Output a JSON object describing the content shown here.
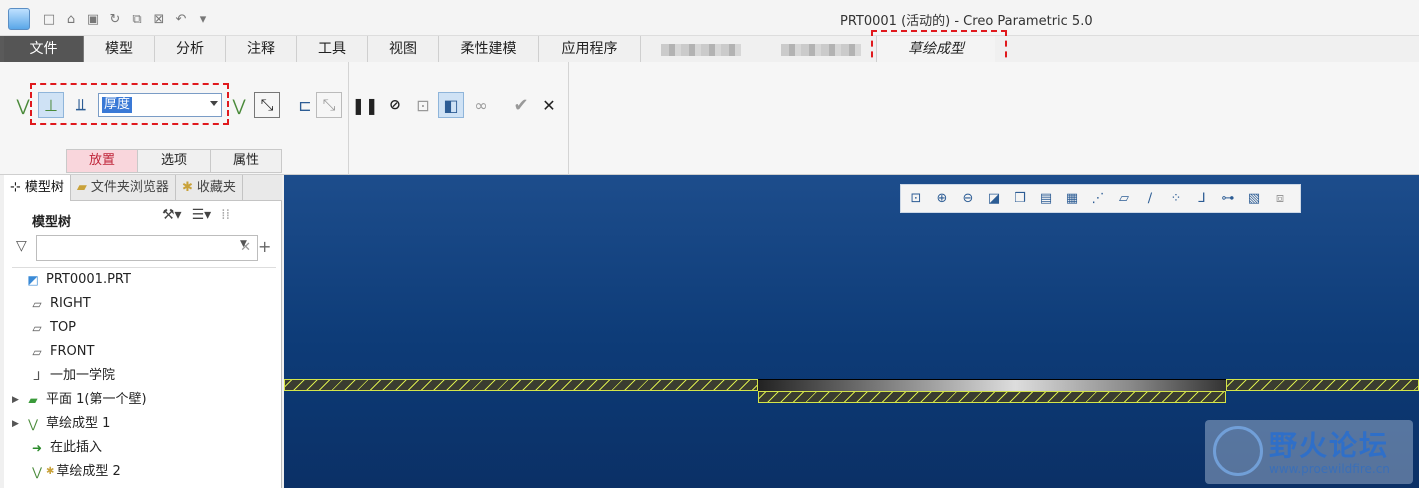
{
  "window": {
    "title": "PRT0001 (活动的) - Creo Parametric 5.0"
  },
  "ribbon_tabs": [
    {
      "label": "文件"
    },
    {
      "label": "模型"
    },
    {
      "label": "分析"
    },
    {
      "label": "注释"
    },
    {
      "label": "工具"
    },
    {
      "label": "视图"
    },
    {
      "label": "柔性建模"
    },
    {
      "label": "应用程序"
    },
    {
      "label": "草绘成型"
    }
  ],
  "ribbon": {
    "type_combo_value": "厚度",
    "sub_tabs": [
      {
        "label": "放置"
      },
      {
        "label": "选项"
      },
      {
        "label": "属性"
      }
    ]
  },
  "panel": {
    "tabs": [
      {
        "label": "模型树"
      },
      {
        "label": "文件夹浏览器"
      },
      {
        "label": "收藏夹"
      }
    ],
    "title": "模型树",
    "filter_value": ""
  },
  "tree": {
    "items": [
      {
        "label": "PRT0001.PRT",
        "icon": "part-icon"
      },
      {
        "label": "RIGHT",
        "icon": "datum-plane-icon"
      },
      {
        "label": "TOP",
        "icon": "datum-plane-icon"
      },
      {
        "label": "FRONT",
        "icon": "datum-plane-icon"
      },
      {
        "label": "一加一学院",
        "icon": "coordinate-system-icon"
      },
      {
        "label": "平面 1(第一个壁)",
        "icon": "planar-wall-icon"
      },
      {
        "label": "草绘成型 1",
        "icon": "sketch-form-icon"
      },
      {
        "label": "在此插入",
        "icon": "insert-here-icon"
      },
      {
        "label": "草绘成型 2",
        "icon": "sketch-form-icon"
      }
    ]
  },
  "watermark": {
    "title": "野火论坛",
    "url": "www.proewildfire.cn"
  },
  "colors": {
    "accent": "#e0191d",
    "viewport_bg": "#0d3b77",
    "hatch": "#d7e84c",
    "active_subtab": "#f9d6dc"
  }
}
